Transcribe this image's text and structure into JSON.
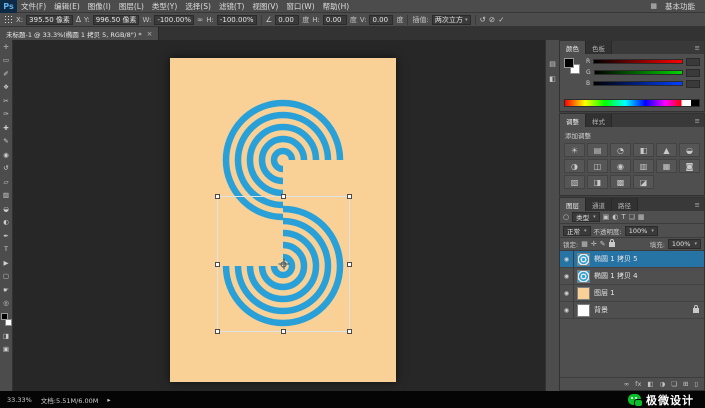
{
  "colors": {
    "accent_blue": "#2aa0d8",
    "canvas_bg": "#f9d196",
    "wechat_green": "#0abf28",
    "selected_layer": "#2673a5"
  },
  "icons": {
    "caret": "▾",
    "eye": "◉",
    "search": "○",
    "menu": "≡"
  },
  "menubar": {
    "logo": "Ps",
    "items": [
      "文件(F)",
      "编辑(E)",
      "图像(I)",
      "图层(L)",
      "类型(Y)",
      "选择(S)",
      "滤镜(T)",
      "视图(V)",
      "窗口(W)",
      "帮助(H)"
    ],
    "ws_icon": "▦",
    "workspace": "基本功能"
  },
  "options": {
    "x_label": "X:",
    "x_value": "395.50 像素",
    "delta_icon": "Δ",
    "y_label": "Y:",
    "y_value": "996.50 像素",
    "w_label": "W:",
    "w_value": "-100.00%",
    "link_icon": "∞",
    "h_label": "H:",
    "h_value": "-100.00%",
    "angle_icon": "∠",
    "angle_value": "0.00",
    "angle_unit": "度",
    "skew_h_label": "H:",
    "skew_h_value": "0.00",
    "skew_h_unit": "度",
    "skew_v_label": "V:",
    "skew_v_value": "0.00",
    "skew_v_unit": "度",
    "interp_label": "插值:",
    "interp_value": "两次立方",
    "history_icon": "↺",
    "cancel_icon": "⊘",
    "commit_icon": "✓"
  },
  "tabbar": {
    "title": "未标题-1 @ 33.3%(椭圆 1 拷贝 5, RGB/8\") *",
    "close": "×"
  },
  "toolbar": {
    "quick_mask": "◨",
    "screen_mode": "▣",
    "tools": [
      {
        "name": "move",
        "glyph": "✛"
      },
      {
        "name": "marquee",
        "glyph": "▭"
      },
      {
        "name": "lasso",
        "glyph": "✐"
      },
      {
        "name": "quick-selection",
        "glyph": "❖"
      },
      {
        "name": "crop",
        "glyph": "✂"
      },
      {
        "name": "eyedropper",
        "glyph": "✑"
      },
      {
        "name": "healing-brush",
        "glyph": "✚"
      },
      {
        "name": "brush",
        "glyph": "✎"
      },
      {
        "name": "clone-stamp",
        "glyph": "◉"
      },
      {
        "name": "history-brush",
        "glyph": "↺"
      },
      {
        "name": "eraser",
        "glyph": "▱"
      },
      {
        "name": "gradient",
        "glyph": "▨"
      },
      {
        "name": "blur",
        "glyph": "◒"
      },
      {
        "name": "dodge",
        "glyph": "◐"
      },
      {
        "name": "pen",
        "glyph": "✒"
      },
      {
        "name": "type",
        "glyph": "T"
      },
      {
        "name": "path-selection",
        "glyph": "▶"
      },
      {
        "name": "shape",
        "glyph": "▢"
      },
      {
        "name": "hand",
        "glyph": "☛"
      },
      {
        "name": "zoom",
        "glyph": "◎"
      }
    ]
  },
  "colors_panel": {
    "tab_color": "颜色",
    "tab_swatches": "色板",
    "channels": [
      "R",
      "G",
      "B"
    ]
  },
  "adjustments_panel": {
    "tab_adjust": "调整",
    "tab_styles": "样式",
    "title": "添加调整",
    "icons": [
      "☀",
      "▤",
      "◔",
      "◧",
      "▲",
      "◒",
      "◑",
      "◫",
      "◉",
      "▥",
      "▦",
      "◙",
      "▧",
      "◨",
      "▩",
      "◪"
    ]
  },
  "layers_panel": {
    "tab_layers": "图层",
    "tab_channels": "通道",
    "tab_paths": "路径",
    "filter_label": "类型",
    "filter_icons": [
      "▣",
      "◐",
      "T",
      "❏",
      "▦"
    ],
    "blend_mode": "正常",
    "opacity_label": "不透明度:",
    "opacity_value": "100%",
    "lock_label": "锁定:",
    "lock_icons": [
      "▦",
      "✛",
      "✎"
    ],
    "fill_label": "填充:",
    "fill_value": "100%",
    "layers": [
      {
        "name": "椭圆 1 拷贝 5"
      },
      {
        "name": "椭圆 1 拷贝 4"
      },
      {
        "name": "图层 1"
      },
      {
        "name": "背景"
      }
    ],
    "footer_icons": [
      "∞",
      "fx",
      "◧",
      "◑",
      "❏",
      "⊞",
      "▯"
    ]
  },
  "dock": {
    "icons": [
      "▤",
      "◧"
    ]
  },
  "statusbar": {
    "zoom": "33.33%",
    "doc_info": "文档:5.51M/6.00M",
    "arrow": "▸"
  },
  "brand": {
    "name": "极微设计"
  }
}
